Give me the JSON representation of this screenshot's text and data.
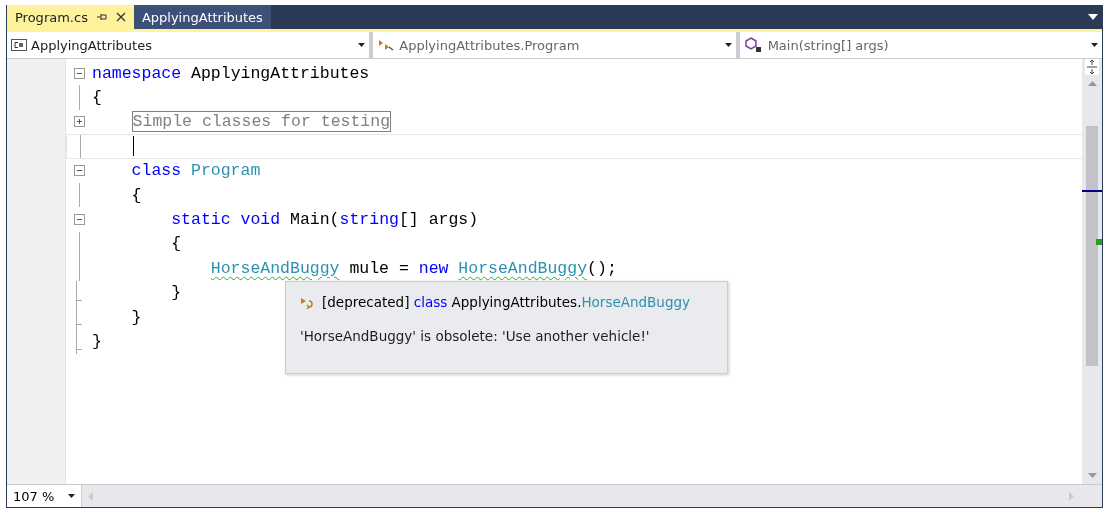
{
  "tabs": [
    {
      "label": "Program.cs",
      "selected": true,
      "pinned": true
    },
    {
      "label": "ApplyingAttributes",
      "selected": false,
      "pinned": false
    }
  ],
  "nav_bar": [
    {
      "label": "ApplyingAttributes",
      "kind": "project"
    },
    {
      "label": "ApplyingAttributes.Program",
      "kind": "class"
    },
    {
      "label": "Main(string[] args)",
      "kind": "method"
    }
  ],
  "code_lines": [
    {
      "kind": "collapse",
      "current": false,
      "tokens": [
        {
          "text": "namespace",
          "kind": "keyword"
        },
        {
          "text": " ApplyingAttributes",
          "kind": "plain"
        }
      ]
    },
    {
      "kind": "line",
      "current": false,
      "tokens": [
        {
          "text": "{",
          "kind": "plain"
        }
      ]
    },
    {
      "kind": "expand",
      "current": false,
      "tokens": [
        {
          "kind": "indent"
        },
        {
          "text": "Simple classes for testing",
          "kind": "collapsed"
        }
      ]
    },
    {
      "kind": "line",
      "current": true,
      "tokens": [
        {
          "kind": "indent"
        },
        {
          "kind": "caret"
        }
      ]
    },
    {
      "kind": "collapse",
      "current": false,
      "tokens": [
        {
          "kind": "indent"
        },
        {
          "text": "class",
          "kind": "keyword"
        },
        {
          "text": " Program",
          "kind": "type"
        }
      ]
    },
    {
      "kind": "line",
      "current": false,
      "tokens": [
        {
          "kind": "indent"
        },
        {
          "text": "{",
          "kind": "plain"
        }
      ]
    },
    {
      "kind": "collapse",
      "current": false,
      "tokens": [
        {
          "kind": "indent"
        },
        {
          "kind": "indent"
        },
        {
          "text": "static void",
          "kind": "keyword"
        },
        {
          "text": " Main(",
          "kind": "plain"
        },
        {
          "text": "string",
          "kind": "keyword"
        },
        {
          "text": "[] args)",
          "kind": "plain"
        }
      ]
    },
    {
      "kind": "line",
      "current": false,
      "tokens": [
        {
          "kind": "indent"
        },
        {
          "kind": "indent"
        },
        {
          "text": "{",
          "kind": "plain"
        }
      ]
    },
    {
      "kind": "line",
      "current": false,
      "tokens": [
        {
          "kind": "indent"
        },
        {
          "kind": "indent"
        },
        {
          "kind": "indent"
        },
        {
          "text": "HorseAndBuggy",
          "kind": "warning"
        },
        {
          "text": " mule = ",
          "kind": "plain"
        },
        {
          "text": "new ",
          "kind": "keyword"
        },
        {
          "text": "HorseAndBuggy",
          "kind": "warning"
        },
        {
          "text": "();",
          "kind": "plain"
        }
      ]
    },
    {
      "kind": "end",
      "current": false,
      "tokens": [
        {
          "kind": "indent"
        },
        {
          "kind": "indent"
        },
        {
          "text": "}",
          "kind": "plain"
        }
      ]
    },
    {
      "kind": "end",
      "current": false,
      "tokens": [
        {
          "kind": "indent"
        },
        {
          "text": "}",
          "kind": "plain"
        }
      ]
    },
    {
      "kind": "end",
      "current": false,
      "tokens": [
        {
          "text": "}",
          "kind": "plain"
        }
      ]
    }
  ],
  "tooltip": {
    "signature": [
      {
        "text": "[deprecated] ",
        "kind": "plain"
      },
      {
        "text": "class",
        "kind": "keyword"
      },
      {
        "text": " ApplyingAttributes.",
        "kind": "plain"
      },
      {
        "text": "HorseAndBuggy",
        "kind": "type"
      }
    ],
    "message": "'HorseAndBuggy' is obsolete: 'Use another vehicle!'"
  },
  "zoom": "107 %"
}
